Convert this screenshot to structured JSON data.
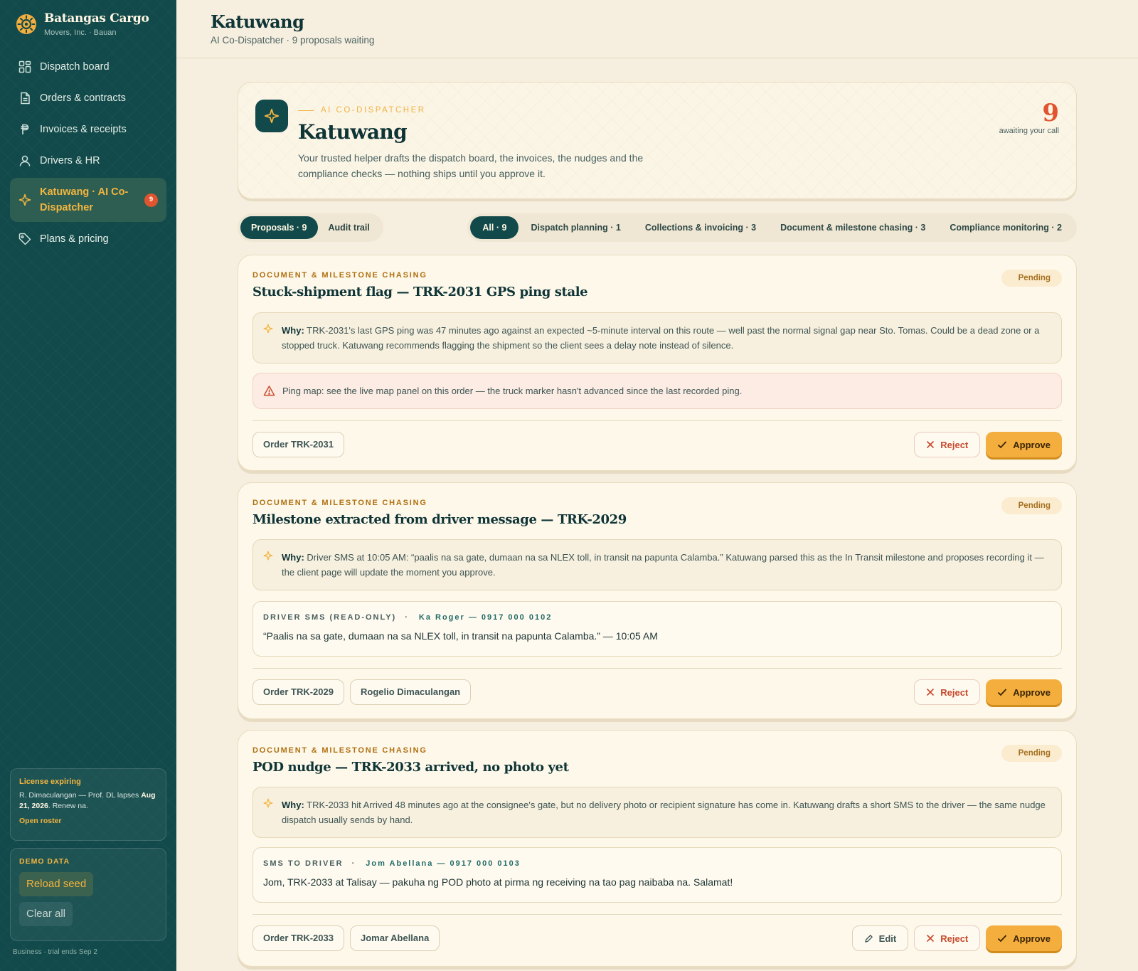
{
  "brand": {
    "name": "Batangas Cargo",
    "sub": "Movers, Inc. · Bauan"
  },
  "nav": [
    {
      "label": "Dispatch board",
      "icon": "grid-icon"
    },
    {
      "label": "Orders & contracts",
      "icon": "document-icon"
    },
    {
      "label": "Invoices & receipts",
      "icon": "peso-icon"
    },
    {
      "label": "Drivers & HR",
      "icon": "person-icon"
    },
    {
      "label": "Katuwang · AI Co-Dispatcher",
      "icon": "sparkle-icon",
      "badge": "9"
    },
    {
      "label": "Plans & pricing",
      "icon": "tag-icon"
    }
  ],
  "license": {
    "title": "License expiring",
    "body_prefix": "R. Dimaculangan — Prof. DL lapses ",
    "body_date": "Aug 21, 2026",
    "body_suffix": ". Renew na.",
    "link": "Open roster"
  },
  "demo": {
    "title": "DEMO DATA",
    "reload": "Reload seed",
    "clear": "Clear all"
  },
  "footnote": "Business · trial ends Sep 2",
  "header": {
    "title": "Katuwang",
    "subtitle": "AI Co-Dispatcher · 9 proposals waiting"
  },
  "hero": {
    "eyebrow": "AI CO-DISPATCHER",
    "title": "Katuwang",
    "description": "Your trusted helper drafts the dispatch board, the invoices, the nudges and the compliance checks — nothing ships until you approve it.",
    "count": "9",
    "count_caption": "awaiting your call"
  },
  "tabs": {
    "proposals": "Proposals · 9",
    "audit": "Audit trail"
  },
  "filters": [
    "All · 9",
    "Dispatch planning · 1",
    "Collections & invoicing · 3",
    "Document & milestone chasing · 3",
    "Compliance monitoring · 2"
  ],
  "cards": [
    {
      "category": "DOCUMENT & MILESTONE CHASING",
      "title": "Stuck-shipment flag — TRK-2031 GPS ping stale",
      "status": "Pending",
      "why_label": "Why:",
      "why": " TRK-2031's last GPS ping was 47 minutes ago against an expected ~5-minute interval on this route — well past the normal signal gap near Sto. Tomas. Could be a dead zone or a stopped truck. Katuwang recommends flagging the shipment so the client sees a delay note instead of silence.",
      "alert": "Ping map: see the live map panel on this order — the truck marker hasn't advanced since the last recorded ping.",
      "chips": [
        "Order TRK-2031"
      ],
      "reject": "Reject",
      "approve": "Approve"
    },
    {
      "category": "DOCUMENT & MILESTONE CHASING",
      "title": "Milestone extracted from driver message — TRK-2029",
      "status": "Pending",
      "why_label": "Why:",
      "why": " Driver SMS at 10:05 AM: “paalis na sa gate, dumaan na sa NLEX toll, in transit na papunta Calamba.” Katuwang parsed this as the In Transit milestone and proposes recording it — the client page will update the moment you approve.",
      "sms_label": "DRIVER SMS (READ-ONLY)",
      "sms_sep": "·",
      "sms_who": "Ka Roger — 0917 000 0102",
      "sms_body": "“Paalis na sa gate, dumaan na sa NLEX toll, in transit na papunta Calamba.” — 10:05 AM",
      "chips": [
        "Order TRK-2029",
        "Rogelio Dimaculangan"
      ],
      "reject": "Reject",
      "approve": "Approve"
    },
    {
      "category": "DOCUMENT & MILESTONE CHASING",
      "title": "POD nudge — TRK-2033 arrived, no photo yet",
      "status": "Pending",
      "why_label": "Why:",
      "why": " TRK-2033 hit Arrived 48 minutes ago at the consignee's gate, but no delivery photo or recipient signature has come in. Katuwang drafts a short SMS to the driver — the same nudge dispatch usually sends by hand.",
      "sms_label": "SMS TO DRIVER",
      "sms_sep": "·",
      "sms_who": "Jom Abellana — 0917 000 0103",
      "sms_body": "Jom, TRK-2033 at Talisay — pakuha ng POD photo at pirma ng receiving na tao pag naibaba na. Salamat!",
      "chips": [
        "Order TRK-2033",
        "Jomar Abellana"
      ],
      "edit": "Edit",
      "reject": "Reject",
      "approve": "Approve"
    }
  ],
  "colors": {
    "sidebar": "#124a4b",
    "accent": "#f3ae3e",
    "danger": "#e0552f",
    "background": "#f6efdf"
  }
}
